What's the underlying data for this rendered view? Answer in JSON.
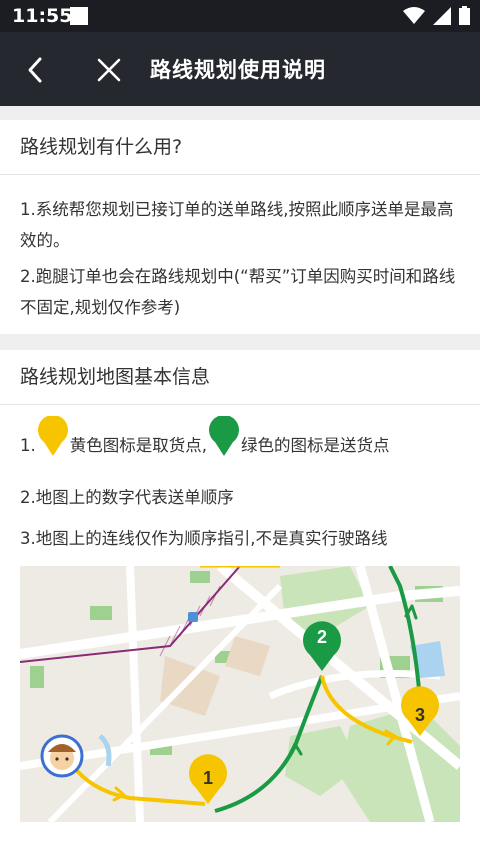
{
  "status_bar": {
    "time": "11:55"
  },
  "nav": {
    "title": "路线规划使用说明"
  },
  "section1": {
    "heading": "路线规划有什么用?",
    "p1": "1.系统帮您规划已接订单的送单路线,按照此顺序送单是最高效的。",
    "p2": "2.跑腿订单也会在路线规划中(“帮买”订单因购买时间和路线不固定,规划仅作参考)"
  },
  "section2": {
    "heading": "路线规划地图基本信息",
    "item1_prefix": "1.",
    "item1_yellow": "黄色图标是取货点,",
    "item1_green": "绿色的图标是送货点",
    "item2": "2.地图上的数字代表送单顺序",
    "item3": "3.地图上的连线仅作为顺序指引,不是真实行驶路线"
  },
  "map": {
    "markers": [
      "1",
      "2",
      "3"
    ],
    "yellow_color": "#f7c400",
    "green_color": "#1a9a45"
  }
}
